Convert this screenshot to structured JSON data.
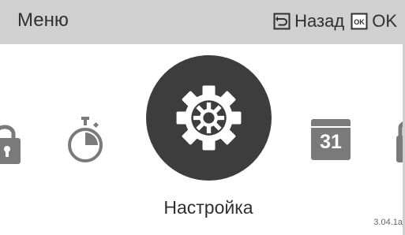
{
  "header": {
    "title": "Меню",
    "back_label": "Назад",
    "ok_label": "OK",
    "back_icon": "back-arrow-icon",
    "ok_icon": "ok-key-icon"
  },
  "carousel": {
    "items": [
      {
        "name": "lock",
        "icon": "lock-icon"
      },
      {
        "name": "timer",
        "icon": "stopwatch-icon"
      },
      {
        "name": "settings",
        "icon": "gear-icon",
        "selected": true
      },
      {
        "name": "calendar",
        "icon": "calendar-icon",
        "text": "31"
      },
      {
        "name": "partial-right",
        "icon": "lock-icon"
      }
    ],
    "selected_label": "Настройка"
  },
  "version": "3.04.1a",
  "colors": {
    "header_bg": "#d0d0d0",
    "selected_circle": "#3d3d3d",
    "icon_gray": "#7a7a7a",
    "text": "#303030"
  }
}
